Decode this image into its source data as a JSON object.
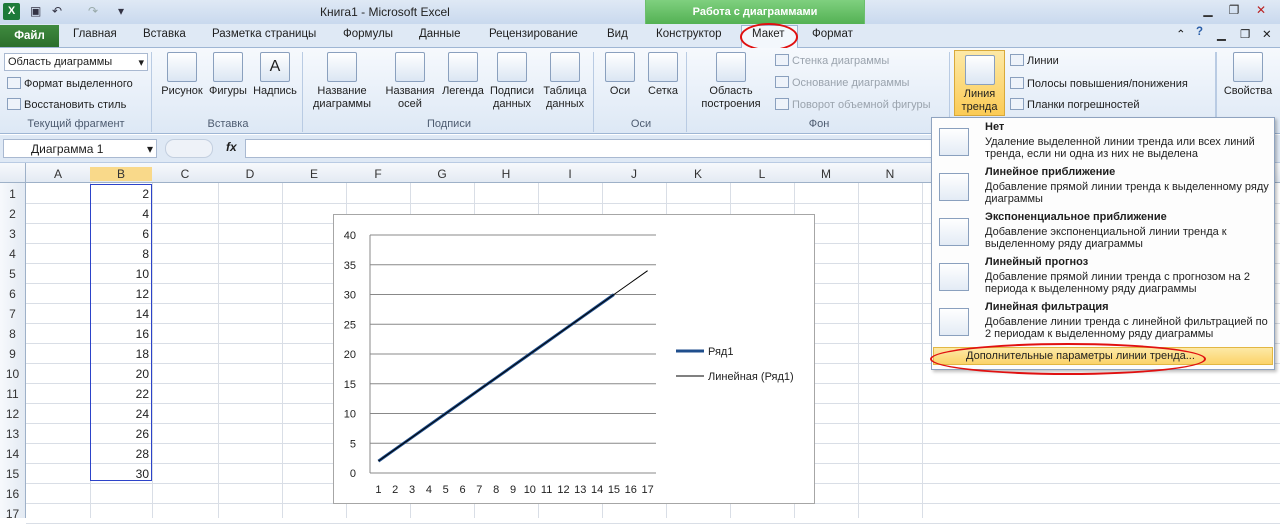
{
  "window": {
    "title": "Книга1  -  Microsoft Excel",
    "context_tab_group": "Работа с диаграммами",
    "app_icon": "X"
  },
  "qat": {
    "save_icon": "save-icon",
    "undo": "↶",
    "redo": "↷",
    "customize": "▾"
  },
  "tabs": [
    "Файл",
    "Главная",
    "Вставка",
    "Разметка страницы",
    "Формулы",
    "Данные",
    "Рецензирование",
    "Вид",
    "Конструктор",
    "Макет",
    "Формат"
  ],
  "active_tab": "Макет",
  "ribbon": {
    "current_fragment": {
      "dropdown_value": "Область диаграммы",
      "format_selected": "Формат выделенного",
      "reset_style": "Восстановить стиль",
      "label": "Текущий фрагмент"
    },
    "insert": {
      "picture": "Рисунок",
      "shapes": "Фигуры",
      "textbox": "Надпись",
      "label": "Вставка"
    },
    "labels": {
      "chart_title": "Название диаграммы",
      "axis_titles": "Названия осей",
      "legend": "Легенда",
      "data_labels": "Подписи данных",
      "data_table": "Таблица данных",
      "label": "Подписи"
    },
    "axes": {
      "axes": "Оси",
      "gridlines": "Сетка",
      "label": "Оси"
    },
    "background": {
      "plot_area": "Область построения",
      "chart_wall": "Стенка диаграммы",
      "chart_floor": "Основание диаграммы",
      "rotation_3d": "Поворот объемной фигуры",
      "label": "Фон"
    },
    "analysis": {
      "trendline": "Линия тренда",
      "lines": "Линии",
      "updown_bars": "Полосы повышения/понижения",
      "error_bars": "Планки погрешностей"
    },
    "properties": {
      "label": "Свойства"
    }
  },
  "formula_bar": {
    "name_box": "Диаграмма 1",
    "fx": "fx",
    "value": ""
  },
  "sheet": {
    "columns": [
      "A",
      "B",
      "C",
      "D",
      "E",
      "F",
      "G",
      "H",
      "I",
      "J",
      "K",
      "L",
      "M",
      "N"
    ],
    "rows": [
      "1",
      "2",
      "3",
      "4",
      "5",
      "6",
      "7",
      "8",
      "9",
      "10",
      "11",
      "12",
      "13",
      "14",
      "15",
      "16",
      "17"
    ],
    "column_b_values": [
      "2",
      "4",
      "6",
      "8",
      "10",
      "12",
      "14",
      "16",
      "18",
      "20",
      "22",
      "24",
      "26",
      "28",
      "30"
    ]
  },
  "chart_data": {
    "type": "line",
    "x": [
      1,
      2,
      3,
      4,
      5,
      6,
      7,
      8,
      9,
      10,
      11,
      12,
      13,
      14,
      15,
      16,
      17
    ],
    "series": [
      {
        "name": "Ряд1",
        "values": [
          2,
          4,
          6,
          8,
          10,
          12,
          14,
          16,
          18,
          20,
          22,
          24,
          26,
          28,
          30,
          32,
          34
        ],
        "color": "#1f4e8c"
      },
      {
        "name": "Линейная (Ряд1)",
        "values": [
          2,
          4,
          6,
          8,
          10,
          12,
          14,
          16,
          18,
          20,
          22,
          24,
          26,
          28,
          30,
          32,
          34
        ],
        "color": "#000000"
      }
    ],
    "ylim": [
      0,
      40
    ],
    "yticks": [
      "0",
      "5",
      "10",
      "15",
      "20",
      "25",
      "30",
      "35",
      "40"
    ],
    "xticks": [
      "1",
      "2",
      "3",
      "4",
      "5",
      "6",
      "7",
      "8",
      "9",
      "10",
      "11",
      "12",
      "13",
      "14",
      "15",
      "16",
      "17"
    ],
    "grid": true,
    "legend_position": "right"
  },
  "trend_menu": {
    "items": [
      {
        "title": "Нет",
        "desc": "Удаление выделенной линии тренда или всех линий тренда, если ни одна из них не выделена"
      },
      {
        "title": "Линейное приближение",
        "desc": "Добавление прямой линии тренда к выделенному ряду диаграммы"
      },
      {
        "title": "Экспоненциальное приближение",
        "desc": "Добавление экспоненциальной линии тренда к выделенному ряду диаграммы"
      },
      {
        "title": "Линейный прогноз",
        "desc": "Добавление прямой линии тренда с прогнозом на 2 периода к выделенному ряду диаграммы"
      },
      {
        "title": "Линейная фильтрация",
        "desc": "Добавление линии тренда с линейной фильтрацией по 2 периодам к выделенному ряду диаграммы"
      }
    ],
    "more_options": "Дополнительные параметры линии тренда..."
  },
  "colors": {
    "accent_green": "#4fae4f",
    "highlight_red": "#e01010",
    "series_blue": "#1f4e8c"
  }
}
